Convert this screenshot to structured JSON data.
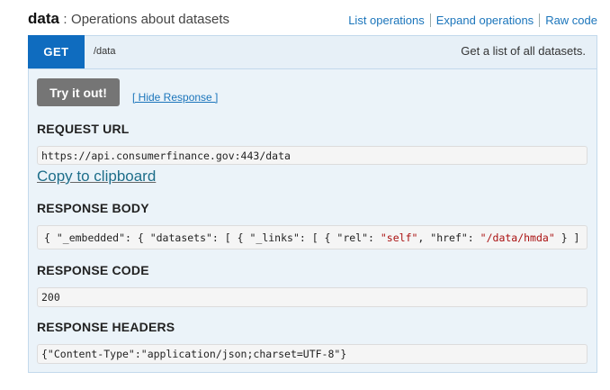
{
  "resource": {
    "name": "data",
    "separator": ":",
    "description": "Operations about datasets"
  },
  "operations_links": {
    "list": "List operations",
    "expand": "Expand operations",
    "raw": "Raw code"
  },
  "operation": {
    "method": "GET",
    "path": "/data",
    "summary": "Get a list of all datasets."
  },
  "actions": {
    "try_button": "Try it out!",
    "hide_response": "[ Hide Response ]",
    "copy_to_clipboard": "Copy to clipboard"
  },
  "request_url": {
    "label": "REQUEST URL",
    "value": "https://api.consumerfinance.gov:443/data"
  },
  "response_body": {
    "label": "RESPONSE BODY",
    "p1": "{ \"_embedded\": { \"datasets\": [ { \"_links\": [ { \"rel\": ",
    "s1": "\"self\"",
    "p2": ", \"href\": ",
    "s2": "\"/data/hmda\"",
    "p3": " } ]"
  },
  "response_code": {
    "label": "RESPONSE CODE",
    "value": "200"
  },
  "response_headers": {
    "label": "RESPONSE HEADERS",
    "value": "{\"Content-Type\":\"application/json;charset=UTF-8\"}"
  },
  "colors": {
    "method_get": "#0f6cbf",
    "panel_bg": "#ebf3f9",
    "link": "#1b75bb",
    "button": "#757575",
    "json_string": "#aa1111"
  }
}
